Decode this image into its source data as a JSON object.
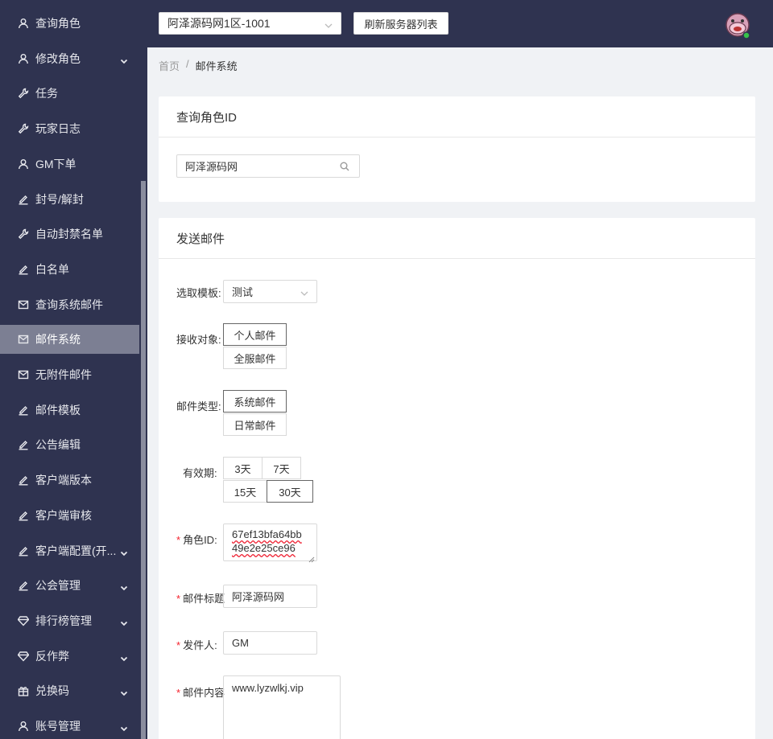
{
  "sidebar": {
    "items": [
      {
        "label": "查询角色",
        "icon": "user-icon",
        "chevron": false
      },
      {
        "label": "修改角色",
        "icon": "user-icon",
        "chevron": true
      },
      {
        "label": "任务",
        "icon": "tool-icon",
        "chevron": false
      },
      {
        "label": "玩家日志",
        "icon": "tool-icon",
        "chevron": false
      },
      {
        "label": "GM下单",
        "icon": "user-icon",
        "chevron": false
      },
      {
        "label": "封号/解封",
        "icon": "edit-icon",
        "chevron": false
      },
      {
        "label": "自动封禁名单",
        "icon": "tool-icon",
        "chevron": false
      },
      {
        "label": "白名单",
        "icon": "edit-icon",
        "chevron": false
      },
      {
        "label": "查询系统邮件",
        "icon": "mail-icon",
        "chevron": false
      },
      {
        "label": "邮件系统",
        "icon": "mail-icon",
        "chevron": false,
        "active": true
      },
      {
        "label": "无附件邮件",
        "icon": "mail-icon",
        "chevron": false
      },
      {
        "label": "邮件模板",
        "icon": "edit-icon",
        "chevron": false
      },
      {
        "label": "公告编辑",
        "icon": "edit-icon",
        "chevron": false
      },
      {
        "label": "客户端版本",
        "icon": "edit-icon",
        "chevron": false
      },
      {
        "label": "客户端审核",
        "icon": "edit-icon",
        "chevron": false
      },
      {
        "label": "客户端配置(开...",
        "icon": "edit-icon",
        "chevron": true
      },
      {
        "label": "公会管理",
        "icon": "edit-icon",
        "chevron": true
      },
      {
        "label": "排行榜管理",
        "icon": "diamond-icon",
        "chevron": true
      },
      {
        "label": "反作弊",
        "icon": "diamond-icon",
        "chevron": true
      },
      {
        "label": "兑换码",
        "icon": "gift-icon",
        "chevron": true
      },
      {
        "label": "账号管理",
        "icon": "user-icon",
        "chevron": true
      }
    ]
  },
  "header": {
    "server_selected": "阿泽源码网1区-1001",
    "refresh_label": "刷新服务器列表"
  },
  "breadcrumb": {
    "home": "首页",
    "separator": "/",
    "current": "邮件系统"
  },
  "query_card": {
    "title": "查询角色ID",
    "search_value": "阿泽源码网"
  },
  "mail_card": {
    "title": "发送邮件",
    "template_label": "选取模板:",
    "template_value": "测试",
    "target_label": "接收对象:",
    "target_options": [
      "个人邮件",
      "全服邮件"
    ],
    "type_label": "邮件类型:",
    "type_options": [
      "系统邮件",
      "日常邮件"
    ],
    "validity_label": "有效期:",
    "validity_options": [
      "3天",
      "7天",
      "15天",
      "30天"
    ],
    "required_mark": "*",
    "role_id_label": "角色ID:",
    "role_id_value": "67ef13bfa64bb49e2e25ce96",
    "role_id_line1": "67ef13bfa64bb",
    "role_id_line2": "49e2e25ce96",
    "mail_title_label": "邮件标题",
    "mail_title_value": "阿泽源码网",
    "sender_label": "发件人:",
    "sender_value": "GM",
    "content_label": "邮件内容",
    "content_value": "www.lyzwlkj.vip"
  },
  "colors": {
    "sidebar_bg": "#2f3350",
    "active_item": "#7c7f93",
    "required": "#f5222d"
  }
}
